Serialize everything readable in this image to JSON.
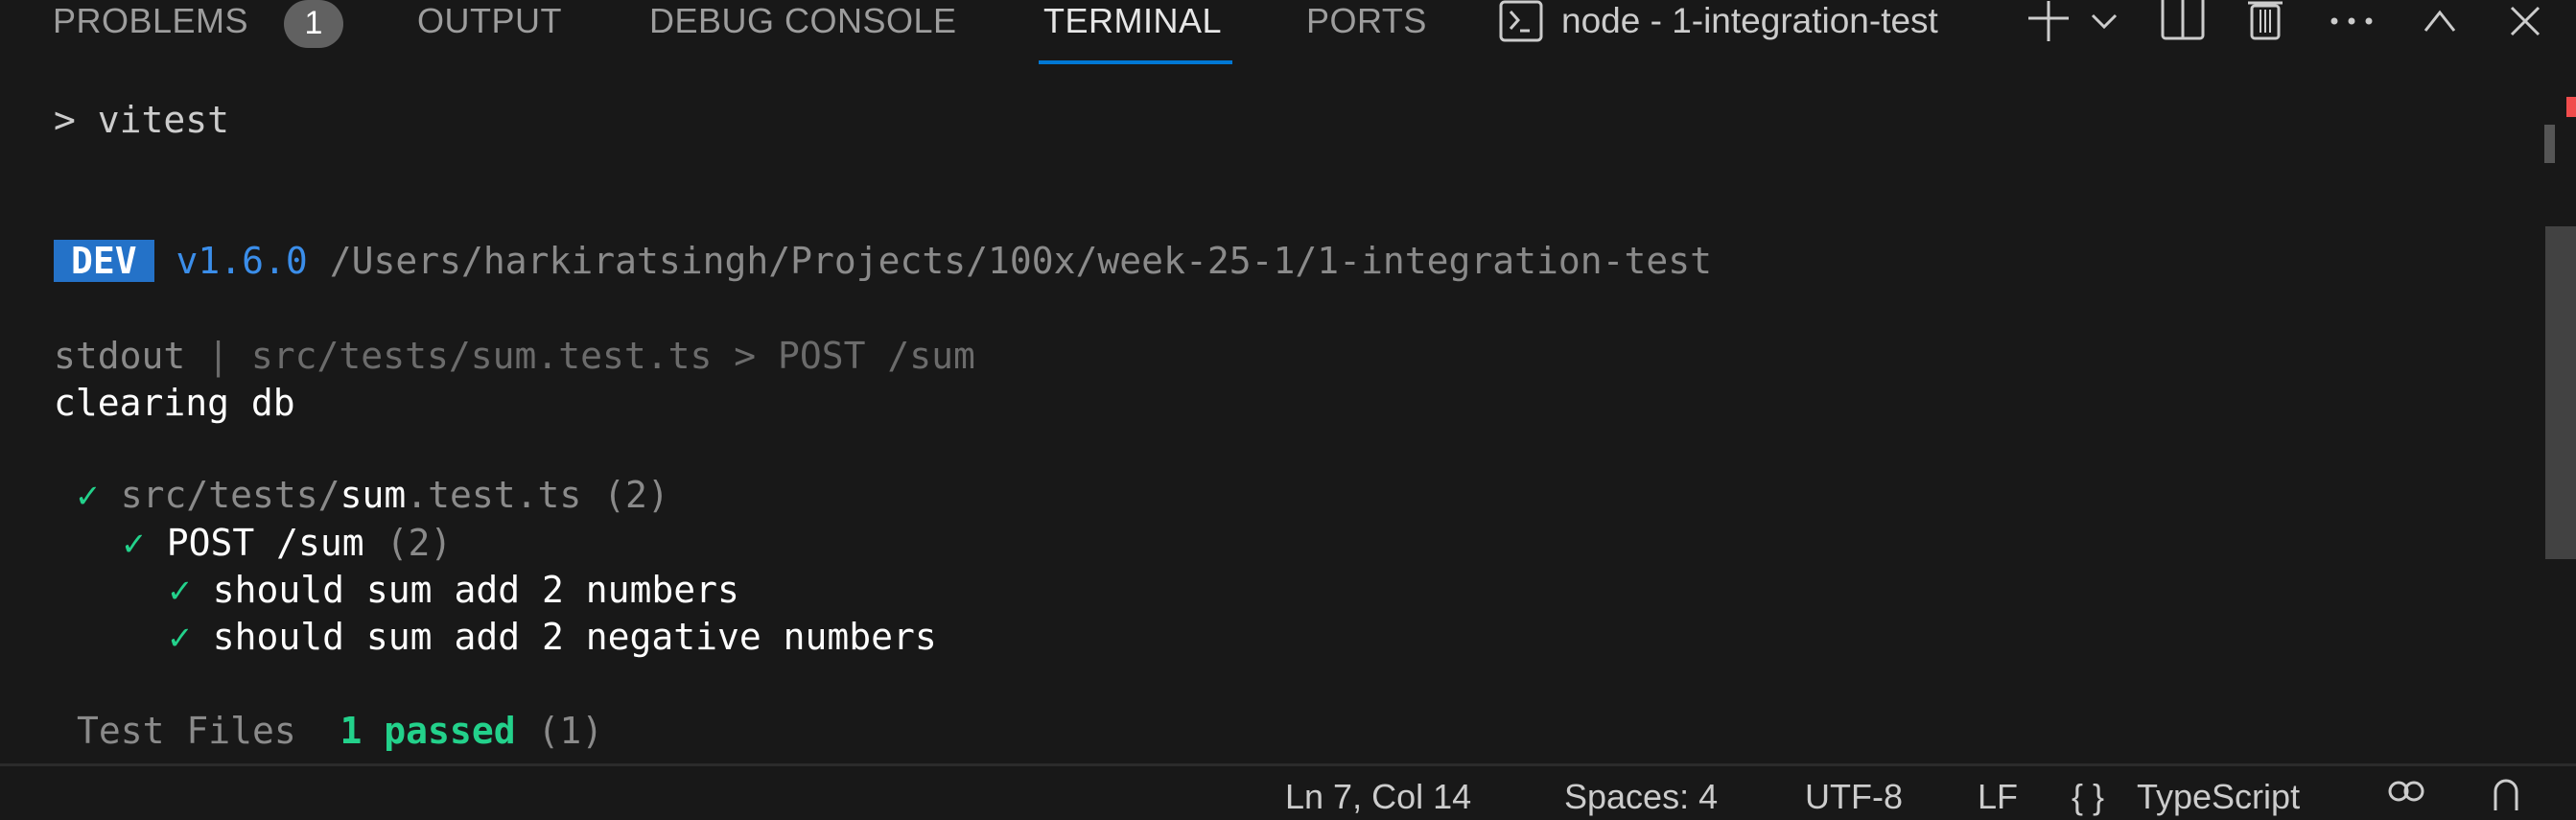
{
  "panel": {
    "tabs": [
      {
        "label": "PROBLEMS",
        "badge": "1"
      },
      {
        "label": "OUTPUT"
      },
      {
        "label": "DEBUG CONSOLE"
      },
      {
        "label": "TERMINAL",
        "active": true
      },
      {
        "label": "PORTS"
      }
    ],
    "terminal_title": "node - 1-integration-test",
    "icons": [
      "terminal-icon",
      "plus-icon",
      "chevron-down-icon",
      "split-icon",
      "trash-icon",
      "ellipsis-icon",
      "chevron-up-icon",
      "close-icon"
    ]
  },
  "terminal": {
    "command": "> vitest",
    "dev_badge": "DEV",
    "version": "v1.6.0",
    "project_path": "/Users/harkiratsingh/Projects/100x/week-25-1/1-integration-test",
    "stdout_label": "stdout",
    "stdout_sep": " | ",
    "stdout_source": "src/tests/sum.test.ts > POST /sum",
    "stdout_output": "clearing db",
    "check": "✓",
    "file_dir": "src/tests/",
    "file_name": "sum",
    "file_ext": ".test.ts",
    "file_count": " (2)",
    "suite_name": "POST /sum",
    "suite_count": " (2)",
    "tests": [
      "should sum add 2 numbers",
      "should sum add 2 negative numbers"
    ],
    "summary_label": "Test Files",
    "summary_passed": "1 passed",
    "summary_total": " (1)"
  },
  "status_bar": {
    "position": "Ln 7, Col 14",
    "spaces": "Spaces: 4",
    "encoding": "UTF-8",
    "eol": "LF",
    "language_icon": "{ }",
    "language": "TypeScript"
  },
  "colors": {
    "background": "#181818",
    "accent": "#0078d4",
    "pass": "#23d18b",
    "dev_badge": "#2472c8",
    "error_marker": "#f14c4c"
  }
}
